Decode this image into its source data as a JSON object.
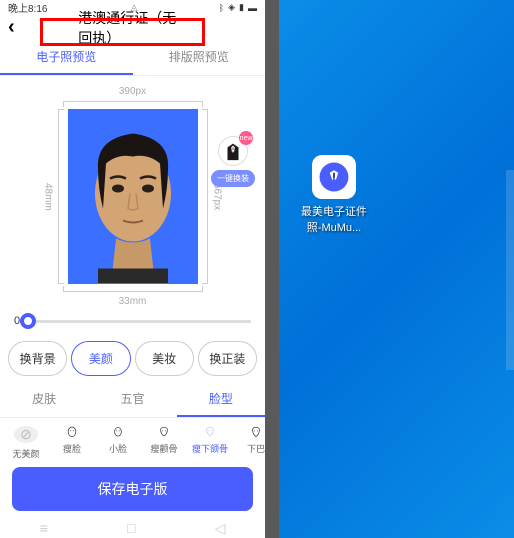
{
  "status": {
    "time": "晚上8:16",
    "bluetooth_icon": "bluetooth",
    "wifi_icon": "wifi",
    "signal_icon": "signal",
    "battery_icon": "battery"
  },
  "header": {
    "title": "港澳通行证（无回执）"
  },
  "tabs": [
    {
      "label": "电子照预览",
      "active": true
    },
    {
      "label": "排版照预览",
      "active": false
    }
  ],
  "dimensions": {
    "width_px": "390px",
    "height_px": "567px",
    "width_mm": "33mm",
    "height_mm": "48mm"
  },
  "outfit": {
    "new_badge": "new",
    "button_label": "一键换装"
  },
  "slider": {
    "value_label": "0"
  },
  "categories": [
    {
      "label": "换背景",
      "active": false
    },
    {
      "label": "美颜",
      "active": true
    },
    {
      "label": "美妆",
      "active": false
    },
    {
      "label": "换正装",
      "active": false
    }
  ],
  "sub_categories": [
    {
      "label": "皮肤",
      "active": false
    },
    {
      "label": "五官",
      "active": false
    },
    {
      "label": "脸型",
      "active": true
    }
  ],
  "face_options": [
    {
      "label": "无美颜",
      "type": "none"
    },
    {
      "label": "瘦脸",
      "type": "face"
    },
    {
      "label": "小脸",
      "type": "face"
    },
    {
      "label": "瘦颧骨",
      "type": "face"
    },
    {
      "label": "瘦下颌骨",
      "type": "face",
      "active": true
    },
    {
      "label": "下巴",
      "type": "face"
    }
  ],
  "save_button": "保存电子版",
  "desktop": {
    "app_label": "最美电子证件照-MuMu..."
  }
}
